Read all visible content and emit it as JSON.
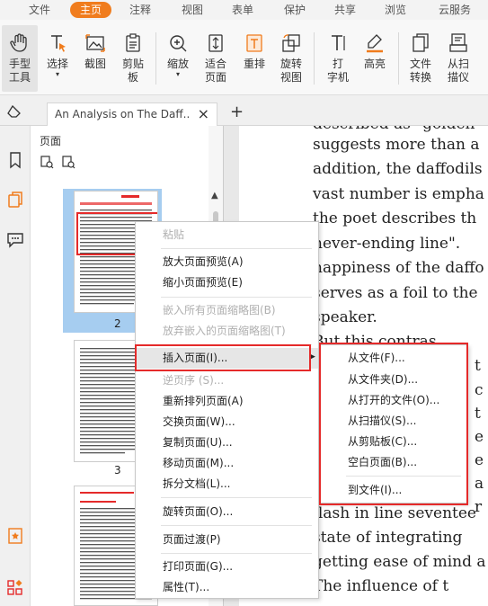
{
  "menu_tabs": [
    "文件",
    "主页",
    "注释",
    "视图",
    "表单",
    "保护",
    "共享",
    "浏览",
    "云服务"
  ],
  "active_tab": "主页",
  "ribbon": {
    "hand_tool": "手型\n工具",
    "select": "选择",
    "screenshot": "截图",
    "clipboard": "剪贴\n板",
    "zoom": "缩放",
    "fit_page": "适合\n页面",
    "reflow": "重排",
    "rotate_view": "旋转\n视图",
    "typewriter": "打\n字机",
    "highlight": "高亮",
    "file_convert": "文件\n转换",
    "from_scanner": "从扫\n描仪"
  },
  "document_tab": {
    "title": "An Analysis on The Daff...",
    "close": "×",
    "new_tab": "+"
  },
  "pages_panel": {
    "title": "页面",
    "page_numbers": [
      "2",
      "3"
    ]
  },
  "document_text": [
    "described as \"golden\"",
    "suggests more than a",
    "addition, the daffodils",
    "vast number is empha",
    "the poet describes th",
    "never-ending line\". ",
    "happiness of the daffo",
    "serves as a foil to the",
    "speaker.",
    "  But this contras",
    "t",
    "c",
    "t",
    "e",
    "e",
    "a",
    "r",
    "flash in line seventee",
    "state of integrating",
    "getting ease of mind a",
    "  The influence of t"
  ],
  "context_menu": {
    "items": [
      {
        "label": "粘贴",
        "disabled": true
      },
      {
        "label": "放大页面预览(A)",
        "disabled": false
      },
      {
        "label": "缩小页面预览(E)",
        "disabled": false
      },
      {
        "label": "嵌入所有页面缩略图(B)",
        "disabled": true
      },
      {
        "label": "放弃嵌入的页面缩略图(T)",
        "disabled": true
      },
      {
        "label": "插入页面(I)...",
        "disabled": false,
        "hover": true,
        "has_submenu": true
      },
      {
        "label": "逆页序 (S)...",
        "disabled": true
      },
      {
        "label": "重新排列页面(A)",
        "disabled": false
      },
      {
        "label": "交换页面(W)...",
        "disabled": false
      },
      {
        "label": "复制页面(U)...",
        "disabled": false
      },
      {
        "label": "移动页面(M)...",
        "disabled": false
      },
      {
        "label": "拆分文档(L)...",
        "disabled": false
      },
      {
        "label": "旋转页面(O)...",
        "disabled": false
      },
      {
        "label": "页面过渡(P)",
        "disabled": false
      },
      {
        "label": "打印页面(G)...",
        "disabled": false
      },
      {
        "label": "属性(T)...",
        "disabled": false
      }
    ]
  },
  "submenu": {
    "items": [
      "从文件(F)...",
      "从文件夹(D)...",
      "从打开的文件(O)...",
      "从扫描仪(S)...",
      "从剪贴板(C)...",
      "空白页面(B)...",
      "到文件(I)..."
    ]
  },
  "colors": {
    "accent": "#f07c1d",
    "selection": "#a6cdf0",
    "highlight_box": "#e52a2a"
  }
}
